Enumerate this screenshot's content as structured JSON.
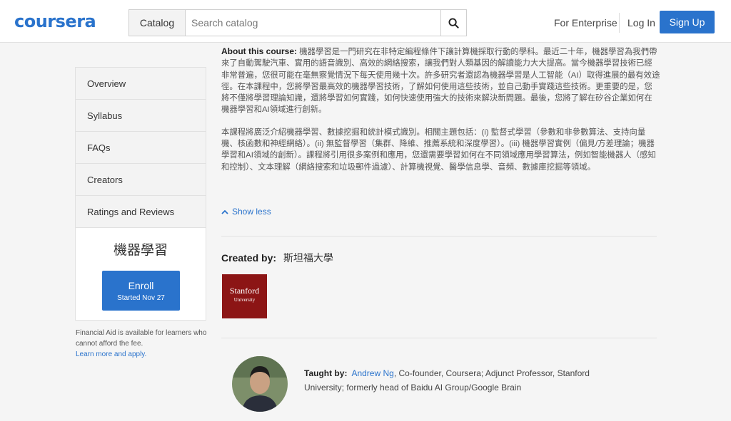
{
  "header": {
    "logo": "coursera",
    "catalog_label": "Catalog",
    "search_placeholder": "Search catalog",
    "enterprise_label": "For Enterprise",
    "login_label": "Log In",
    "signup_label": "Sign Up"
  },
  "sidebar": {
    "items": [
      {
        "label": "Overview"
      },
      {
        "label": "Syllabus"
      },
      {
        "label": "FAQs"
      },
      {
        "label": "Creators"
      },
      {
        "label": "Ratings and Reviews"
      }
    ]
  },
  "enroll": {
    "course_title": "機器學習",
    "button_label": "Enroll",
    "button_sub": "Started Nov 27",
    "fin_aid_text": "Financial Aid is available for learners who cannot afford the fee.",
    "fin_aid_link": "Learn more and apply."
  },
  "about": {
    "heading": "About this course:",
    "para1": "機器學習是一門研究在非特定編程條件下讓計算機採取行動的學科。最近二十年，機器學習為我們帶來了自動駕駛汽車、實用的語音識別、高效的網絡搜索，讓我們對人類基因的解讀能力大大提高。當今機器學習技術已經非常普遍，您很可能在毫無察覺情況下每天使用幾十次。許多研究者還認為機器學習是人工智能（AI）取得進展的最有效途徑。在本課程中，您將學習最高效的機器學習技術，了解如何使用這些技術，並自己動手實踐這些技術。更重要的是，您將不僅將學習理論知識，還將學習如何實踐，如何快速使用強大的技術來解決新問題。最後，您將了解在矽谷企業如何在機器學習和AI領域進行創新。",
    "para2": "本課程將廣泛介紹機器學習、數據挖掘和統計模式識別。相關主題包括：(i) 監督式學習（參數和非參數算法、支持向量機、核函數和神經網絡）。(ii) 無監督學習（集群、降維、推薦系統和深度學習）。(iii) 機器學習實例（偏見/方差理論；機器學習和AI領域的創新）。課程將引用很多案例和應用，您還需要學習如何在不同領域應用學習算法，例如智能機器人（感知和控制）、文本理解（網絡搜索和垃圾郵件過濾）、計算機視覺、醫學信息學、音頻、數據庫挖掘等領域。",
    "show_less": "Show less"
  },
  "creators": {
    "label": "Created by:",
    "name": "斯坦福大學",
    "logo_line1": "Stanford",
    "logo_line2": "University"
  },
  "instructor": {
    "label": "Taught by:",
    "name": "Andrew Ng",
    "bio": ", Co-founder, Coursera; Adjunct Professor, Stanford University; formerly head of Baidu AI Group/Google Brain"
  },
  "colors": {
    "brand_blue": "#2a73cc",
    "stanford_red": "#8c1515"
  }
}
